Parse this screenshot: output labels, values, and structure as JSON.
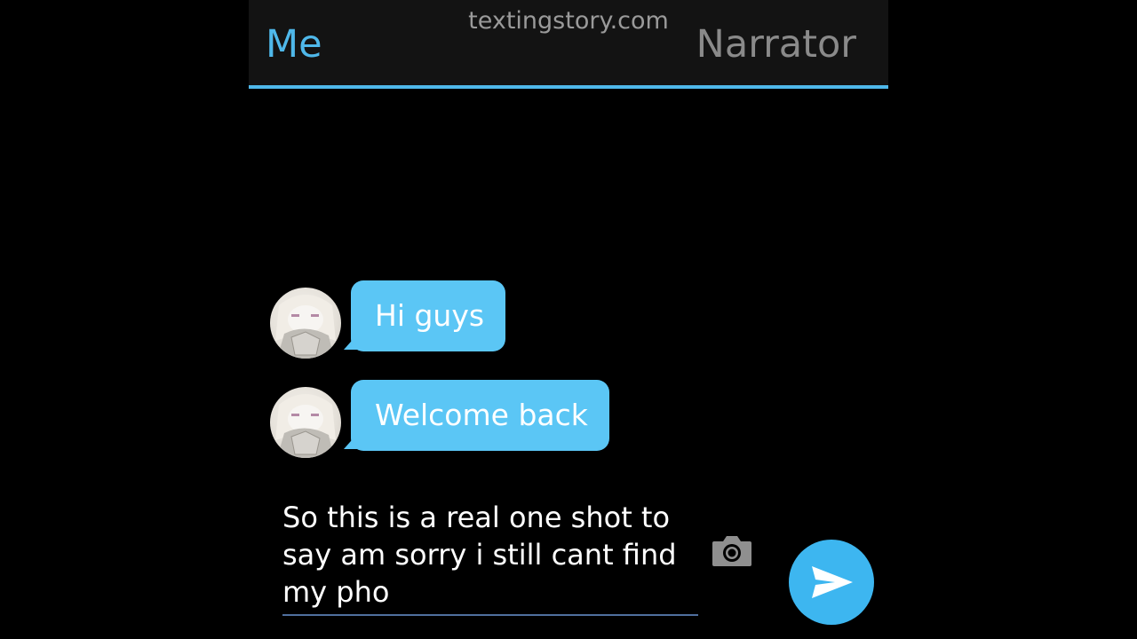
{
  "header": {
    "tab_me": "Me",
    "watermark": "textingstory.com",
    "tab_narrator": "Narrator"
  },
  "messages": [
    {
      "text": "Hi guys"
    },
    {
      "text": "Welcome back"
    }
  ],
  "composer": {
    "value": "So this is a real one shot to\nsay am sorry i still cant find\nmy pho"
  },
  "icons": {
    "camera": "camera-icon",
    "send": "send-icon"
  },
  "colors": {
    "accent": "#4fb8ea",
    "bubble": "#5bc6f5",
    "send_button": "#3db6f0",
    "background": "#000000",
    "header": "#131313"
  }
}
